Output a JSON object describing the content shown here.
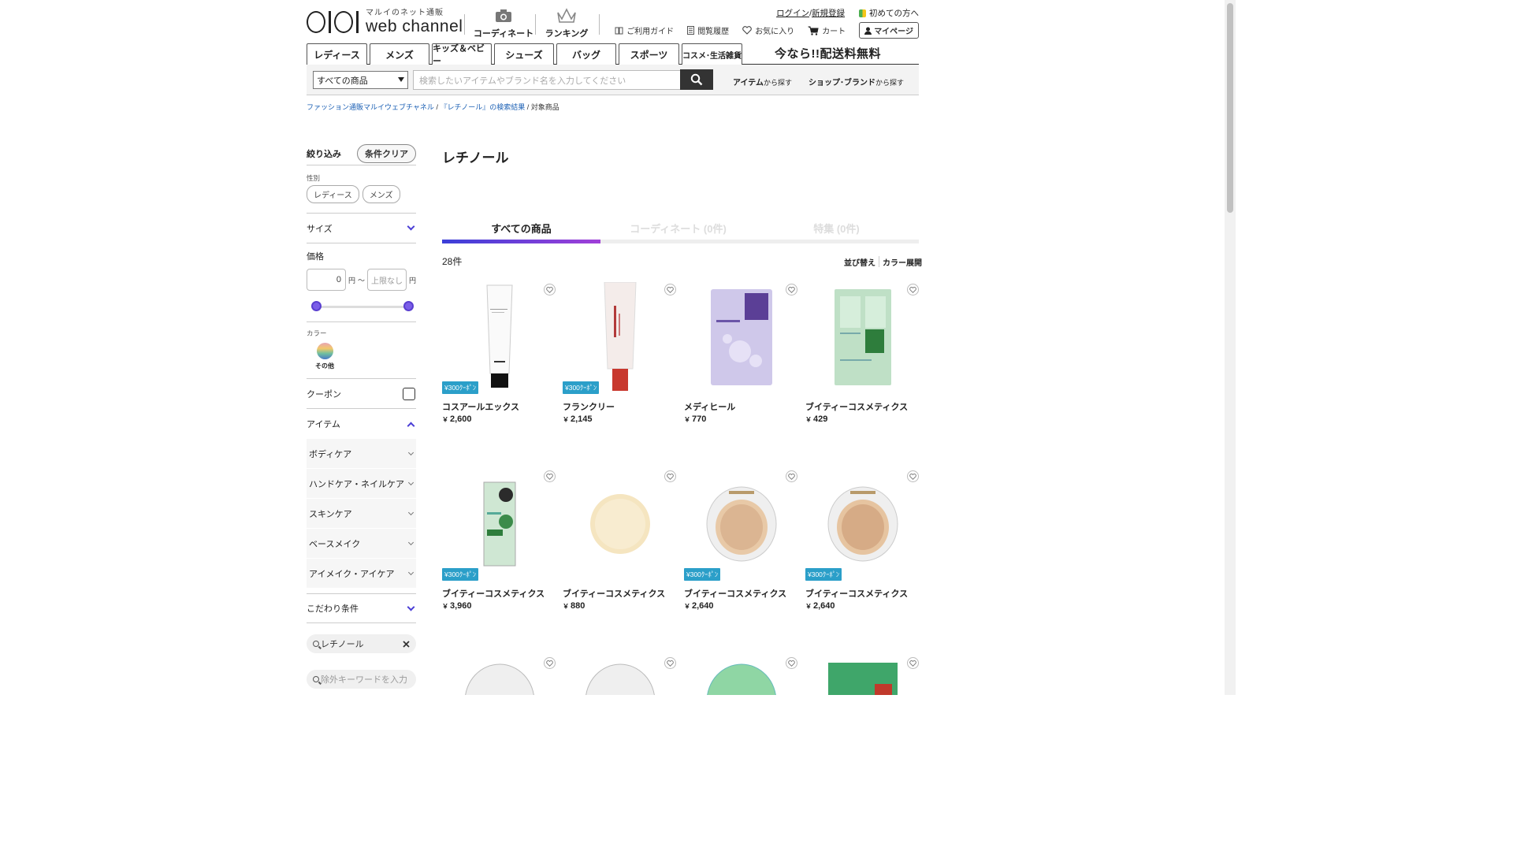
{
  "header": {
    "logo_sub": "マルイのネット通販",
    "logo_main": "web channel",
    "coordinate_label": "コーディネート",
    "ranking_label": "ランキング",
    "login_label": "ログイン",
    "slash": "/",
    "register_label": "新規登録",
    "first_time_label": "初めての方へ",
    "guide_label": "ご利用ガイド",
    "history_label": "閲覧履歴",
    "favorites_label": "お気に入り",
    "cart_label": "カート",
    "mypage_label": "マイページ"
  },
  "categories": [
    "レディース",
    "メンズ",
    "キッズ＆ベビー",
    "シューズ",
    "バッグ",
    "スポーツ",
    "コスメ･生活雑貨"
  ],
  "promo": "今なら!!配送料無料",
  "search": {
    "scope": "すべての商品",
    "placeholder": "検索したいアイテムやブランド名を入力してください",
    "item_link": "アイテム",
    "item_link_suffix": "から探す",
    "shop_link": "ショップ･ブランド",
    "shop_link_suffix": "から探す"
  },
  "breadcrumb": {
    "home": "ファッション通販マルイウェブチャネル",
    "results": "『レチノール』の検索結果",
    "sep": "/",
    "current": "対象商品"
  },
  "sidebar": {
    "narrow_label": "絞り込み",
    "clear_label": "条件クリア",
    "gender_label": "性別",
    "gender_options": [
      "レディース",
      "メンズ"
    ],
    "size_label": "サイズ",
    "price_label": "価格",
    "price_min": "0",
    "price_max_placeholder": "上限なし",
    "yen": "円",
    "tilde": "～",
    "color_label": "カラー",
    "color_swatch_label": "その他",
    "coupon_label": "クーポン",
    "item_label": "アイテム",
    "item_subs": [
      "ボディケア",
      "ハンドケア・ネイルケア",
      "スキンケア",
      "ベースメイク",
      "アイメイク・アイケア"
    ],
    "kodawari_label": "こだわり条件",
    "keyword": "レチノール",
    "exclude_placeholder": "除外キーワードを入力"
  },
  "main": {
    "title": "レチノール",
    "tabs": [
      "すべての商品",
      "コーディネート (0件)",
      "特集 (0件)"
    ],
    "count": "28件",
    "sort_label": "並び替え",
    "color_expand_label": "カラー展開"
  },
  "coupon_text": "¥300ｸｰﾎﾟﾝ",
  "yen_mark": "￥",
  "products": [
    {
      "brand": "コスアールエックス",
      "price": "2,600",
      "coupon": true
    },
    {
      "brand": "フランクリー",
      "price": "2,145",
      "coupon": true
    },
    {
      "brand": "メディヒール",
      "price": "770",
      "coupon": false
    },
    {
      "brand": "ブイティーコスメティクス",
      "price": "429",
      "coupon": false
    },
    {
      "brand": "ブイティーコスメティクス",
      "price": "3,960",
      "coupon": true
    },
    {
      "brand": "ブイティーコスメティクス",
      "price": "880",
      "coupon": false
    },
    {
      "brand": "ブイティーコスメティクス",
      "price": "2,640",
      "coupon": true
    },
    {
      "brand": "ブイティーコスメティクス",
      "price": "2,640",
      "coupon": true
    }
  ],
  "colors": {
    "accent": "#4b3fd6",
    "coupon": "#2b9fc9",
    "search_button": "#333333"
  }
}
